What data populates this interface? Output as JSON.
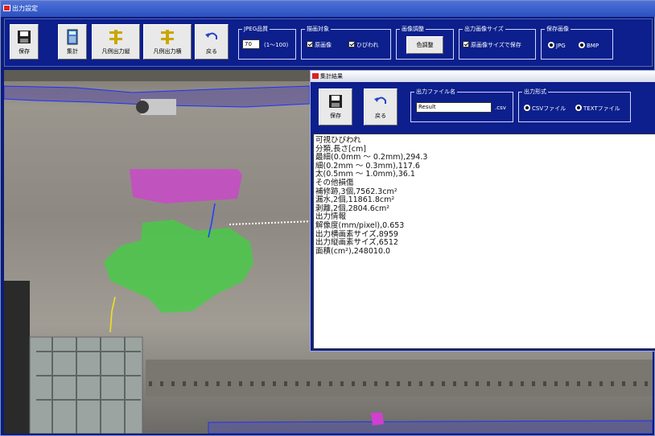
{
  "window": {
    "title": "出力設定"
  },
  "toolbar": {
    "save": "保存",
    "aggregate": "集計",
    "legend_vertical": "凡例出力縦",
    "legend_horizontal": "凡例出力横",
    "back": "戻る",
    "jpeg_quality": {
      "title": "JPEG品質",
      "value": "70",
      "range": "(1〜100)"
    },
    "draw_target": {
      "title": "描画対象",
      "original": "原画像",
      "cracks": "ひびわれ"
    },
    "image_adjust": {
      "title": "画像調整",
      "button": "色調整"
    },
    "output_size": {
      "title": "出力画像サイズ",
      "option": "原画像サイズで保存"
    },
    "save_image": {
      "title": "保存画像",
      "jpg": "JPG",
      "bmp": "BMP",
      "selected": "JPG"
    }
  },
  "dialog": {
    "title": "集計結果",
    "save": "保存",
    "back": "戻る",
    "filename": {
      "title": "出力ファイル名",
      "value": "Result",
      "ext": ".csv"
    },
    "format": {
      "title": "出力形式",
      "csv": "CSVファイル",
      "text": "TEXTファイル",
      "selected": "CSVファイル"
    },
    "results": [
      "可視ひびわれ",
      "分類,長さ[cm]",
      "最細(0.0mm 〜 0.2mm),294.3",
      "細(0.2mm 〜 0.3mm),117.6",
      "太(0.5mm 〜 1.0mm),36.1",
      "その他損傷",
      "補修跡,3個,7562.3cm²",
      "漏水,2個,11861.8cm²",
      "剥離,2個,2804.6cm²",
      "出力情報",
      "解像度(mm/pixel),0.653",
      "出力横画素サイズ,8959",
      "出力縦画素サイズ,6512",
      "面積(cm²),248010.0"
    ]
  },
  "colors": {
    "toolbar": "#0c1f8c",
    "titlebar": "#3a5fcf",
    "repair": "#d040d0",
    "leak": "#40d040",
    "crack_blue": "#2040ff",
    "crack_yellow": "#f0e020"
  }
}
